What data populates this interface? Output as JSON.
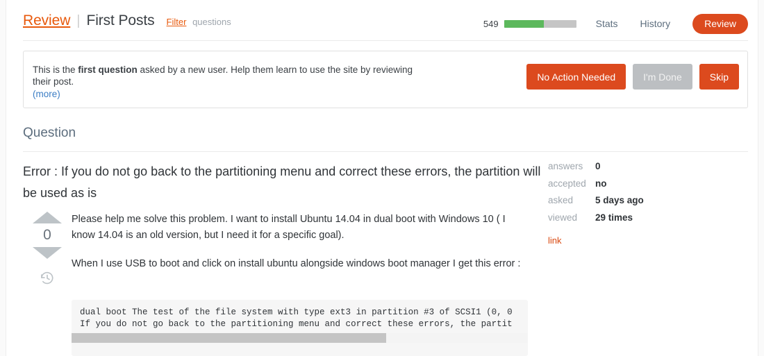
{
  "header": {
    "brand": "Review",
    "separator": "|",
    "queue_title": "First Posts",
    "filter_label": "Filter",
    "filter_scope": "questions",
    "progress_count": "549",
    "progress_percent": 55,
    "nav": [
      {
        "label": "Stats"
      },
      {
        "label": "History"
      }
    ],
    "review_button": "Review"
  },
  "notice": {
    "text_before": "This is the ",
    "text_bold": "first question",
    "text_after": " asked by a new user. Help them learn to use the site by reviewing their post.",
    "more_label": "(more)",
    "actions": [
      {
        "label": "No Action Needed",
        "state": "enabled"
      },
      {
        "label": "I'm Done",
        "state": "disabled"
      },
      {
        "label": "Skip",
        "state": "enabled"
      }
    ]
  },
  "section": {
    "title": "Question"
  },
  "post": {
    "title": "Error : If you do not go back to the partitioning menu and correct these errors, the partition will be used as is",
    "vote_count": "0",
    "history_icon": "clock-history-icon",
    "upvote_icon": "arrow-up-icon",
    "downvote_icon": "arrow-down-icon",
    "paragraphs": [
      "Please help me solve this problem. I want to install Ubuntu 14.04 in dual boot with Windows 10 ( I know 14.04 is an old version, but I need it for a specific goal).",
      "When I use USB to boot and click on install ubuntu alongside windows boot manager I get this error :"
    ],
    "code": "dual boot The test of the file system with type ext3 in partition #3 of SCSI1 (0, 0\nIf you do not go back to the partitioning menu and correct these errors, the partit",
    "code_scroll_percent": 69
  },
  "stats": {
    "rows": [
      {
        "label": "answers",
        "value": "0"
      },
      {
        "label": "accepted",
        "value": "no"
      },
      {
        "label": "asked",
        "value": "5 days ago"
      },
      {
        "label": "viewed",
        "value": "29 times"
      }
    ],
    "link_label": "link"
  },
  "colors": {
    "accent_orange": "#dc4a1e",
    "brand_orange": "#e8590c",
    "progress_green": "#5cb85c",
    "link_blue": "#3b7dc4",
    "muted_gray": "#9fa6ad"
  }
}
